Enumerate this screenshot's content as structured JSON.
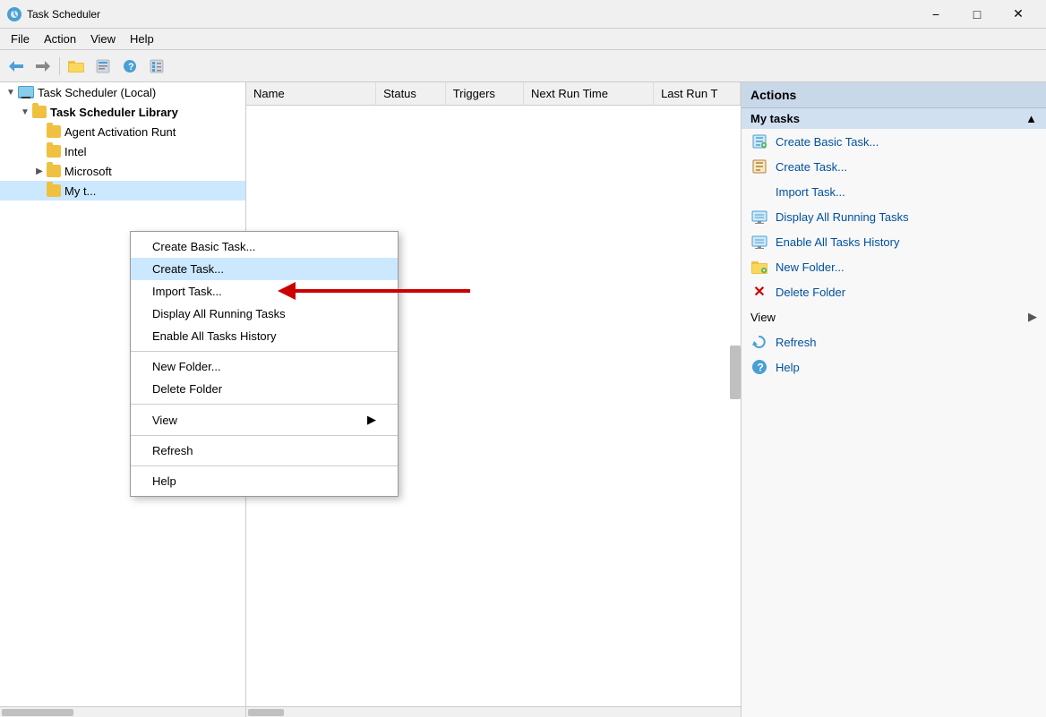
{
  "titleBar": {
    "title": "Task Scheduler",
    "minimizeLabel": "−",
    "maximizeLabel": "□",
    "closeLabel": "✕"
  },
  "menuBar": {
    "items": [
      "File",
      "Action",
      "View",
      "Help"
    ]
  },
  "toolbar": {
    "buttons": [
      "←",
      "→",
      "📁",
      "⊞",
      "?",
      "⊡"
    ]
  },
  "tree": {
    "items": [
      {
        "label": "Task Scheduler (Local)",
        "indent": 0,
        "type": "computer",
        "expanded": true
      },
      {
        "label": "Task Scheduler Library",
        "indent": 1,
        "type": "folder",
        "expanded": true
      },
      {
        "label": "Agent Activation Runt",
        "indent": 2,
        "type": "folder"
      },
      {
        "label": "Intel",
        "indent": 2,
        "type": "folder"
      },
      {
        "label": "Microsoft",
        "indent": 2,
        "type": "folder",
        "hasExpander": true
      },
      {
        "label": "My t...",
        "indent": 2,
        "type": "folder",
        "selected": true
      }
    ]
  },
  "contentColumns": [
    {
      "label": "Name",
      "key": "name"
    },
    {
      "label": "Status",
      "key": "status"
    },
    {
      "label": "Triggers",
      "key": "triggers"
    },
    {
      "label": "Next Run Time",
      "key": "nextRun"
    },
    {
      "label": "Last Run T",
      "key": "lastRun"
    }
  ],
  "actionsPanel": {
    "header": "Actions",
    "sectionLabel": "My tasks",
    "items": [
      {
        "label": "Create Basic Task...",
        "icon": "task-icon",
        "color": "#4a9fd4"
      },
      {
        "label": "Create Task...",
        "icon": "task-icon2",
        "color": "#b08040"
      },
      {
        "label": "Import Task...",
        "icon": null
      },
      {
        "label": "Display All Running Tasks",
        "icon": "running-icon",
        "color": "#4a9fd4"
      },
      {
        "label": "Enable All Tasks History",
        "icon": "history-icon",
        "color": "#4a9fd4"
      },
      {
        "label": "New Folder...",
        "icon": "folder-icon",
        "color": "#f0c040"
      },
      {
        "label": "Delete Folder",
        "icon": "delete-icon",
        "color": "#cc0000"
      },
      {
        "label": "View",
        "icon": null,
        "hasArrow": true
      },
      {
        "label": "Refresh",
        "icon": "refresh-icon",
        "color": "#4a9fd4"
      },
      {
        "label": "Help",
        "icon": "help-icon",
        "color": "#4a9fd4"
      }
    ]
  },
  "contextMenu": {
    "items": [
      {
        "label": "Create Basic Task...",
        "type": "item"
      },
      {
        "label": "Create Task...",
        "type": "item",
        "highlighted": true
      },
      {
        "label": "Import Task...",
        "type": "item"
      },
      {
        "label": "Display All Running Tasks",
        "type": "item"
      },
      {
        "label": "Enable All Tasks History",
        "type": "item"
      },
      {
        "type": "separator"
      },
      {
        "label": "New Folder...",
        "type": "item"
      },
      {
        "label": "Delete Folder",
        "type": "item"
      },
      {
        "type": "separator"
      },
      {
        "label": "View",
        "type": "item",
        "hasArrow": true
      },
      {
        "type": "separator"
      },
      {
        "label": "Refresh",
        "type": "item"
      },
      {
        "type": "separator"
      },
      {
        "label": "Help",
        "type": "item"
      }
    ]
  }
}
